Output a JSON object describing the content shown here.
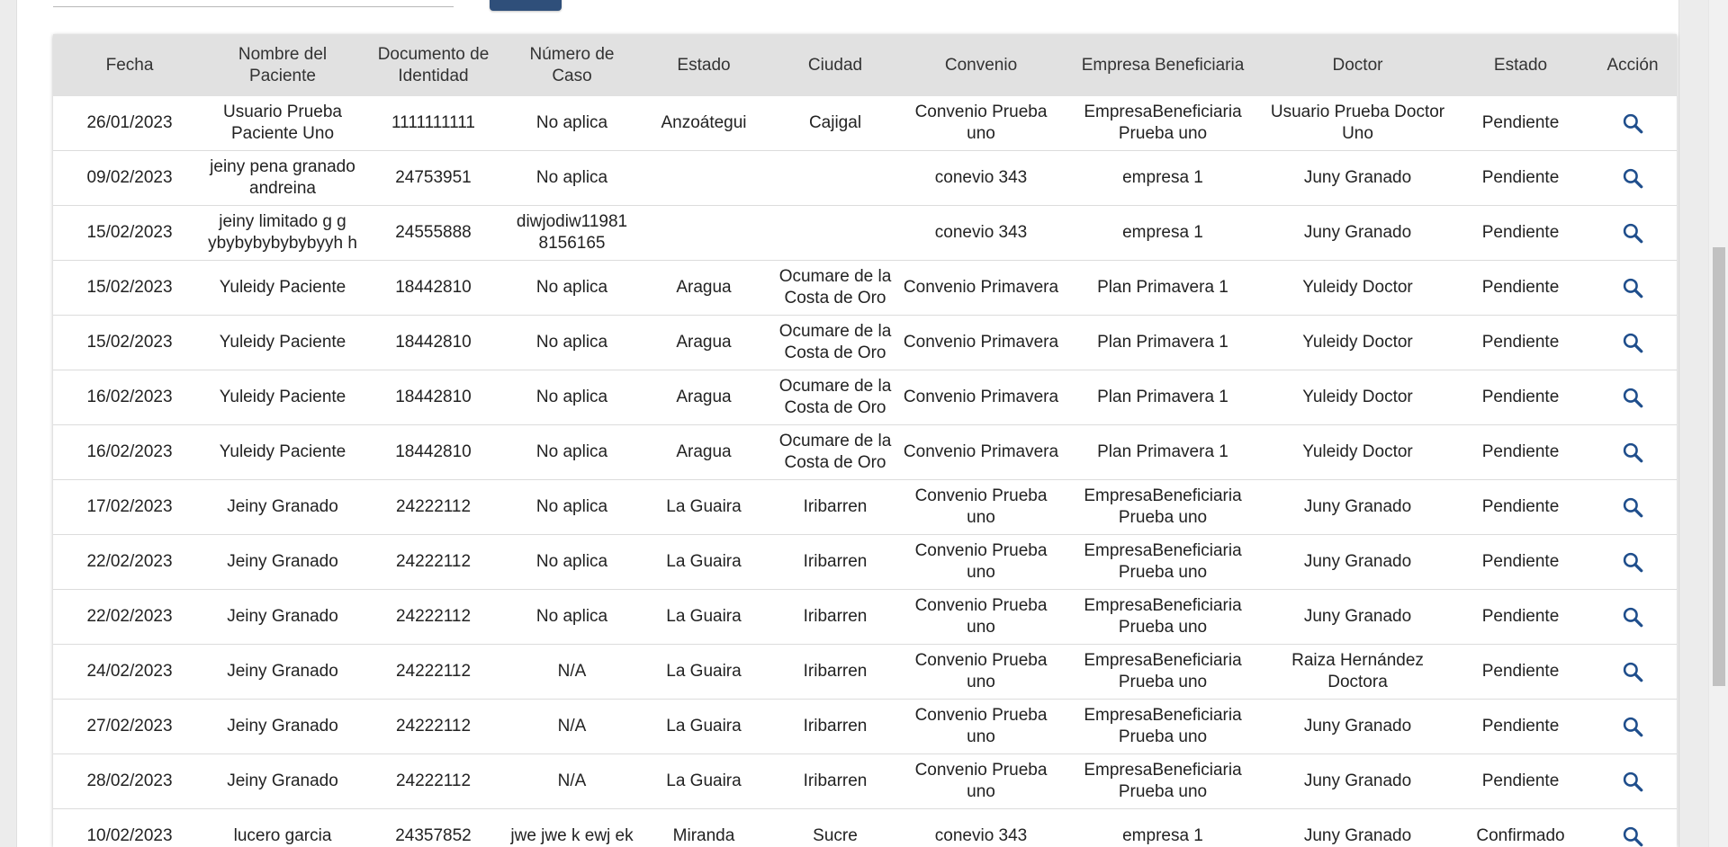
{
  "table": {
    "headers": [
      "Fecha",
      "Nombre del Paciente",
      "Documento de Identidad",
      "Número de Caso",
      "Estado",
      "Ciudad",
      "Convenio",
      "Empresa Beneficiaria",
      "Doctor",
      "Estado",
      "Acción"
    ],
    "action_icon": "search-icon",
    "rows": [
      [
        "26/01/2023",
        "Usuario Prueba Paciente Uno",
        "1111111111",
        "No aplica",
        "Anzoátegui",
        "Cajigal",
        "Convenio Prueba uno",
        "EmpresaBeneficiaria Prueba uno",
        "Usuario Prueba Doctor Uno",
        "Pendiente"
      ],
      [
        "09/02/2023",
        "jeiny pena granado andreina",
        "24753951",
        "No aplica",
        "",
        "",
        "conevio 343",
        "empresa 1",
        "Juny Granado",
        "Pendiente"
      ],
      [
        "15/02/2023",
        "jeiny limitado g g ybybybybybybyyh h",
        "24555888",
        "diwjodiw11981 8156165",
        "",
        "",
        "conevio 343",
        "empresa 1",
        "Juny Granado",
        "Pendiente"
      ],
      [
        "15/02/2023",
        "Yuleidy Paciente",
        "18442810",
        "No aplica",
        "Aragua",
        "Ocumare de la Costa de Oro",
        "Convenio Primavera",
        "Plan Primavera 1",
        "Yuleidy Doctor",
        "Pendiente"
      ],
      [
        "15/02/2023",
        "Yuleidy Paciente",
        "18442810",
        "No aplica",
        "Aragua",
        "Ocumare de la Costa de Oro",
        "Convenio Primavera",
        "Plan Primavera 1",
        "Yuleidy Doctor",
        "Pendiente"
      ],
      [
        "16/02/2023",
        "Yuleidy Paciente",
        "18442810",
        "No aplica",
        "Aragua",
        "Ocumare de la Costa de Oro",
        "Convenio Primavera",
        "Plan Primavera 1",
        "Yuleidy Doctor",
        "Pendiente"
      ],
      [
        "16/02/2023",
        "Yuleidy Paciente",
        "18442810",
        "No aplica",
        "Aragua",
        "Ocumare de la Costa de Oro",
        "Convenio Primavera",
        "Plan Primavera 1",
        "Yuleidy Doctor",
        "Pendiente"
      ],
      [
        "17/02/2023",
        "Jeiny Granado",
        "24222112",
        "No aplica",
        "La Guaira",
        "Iribarren",
        "Convenio Prueba uno",
        "EmpresaBeneficiaria Prueba uno",
        "Juny Granado",
        "Pendiente"
      ],
      [
        "22/02/2023",
        "Jeiny Granado",
        "24222112",
        "No aplica",
        "La Guaira",
        "Iribarren",
        "Convenio Prueba uno",
        "EmpresaBeneficiaria Prueba uno",
        "Juny Granado",
        "Pendiente"
      ],
      [
        "22/02/2023",
        "Jeiny Granado",
        "24222112",
        "No aplica",
        "La Guaira",
        "Iribarren",
        "Convenio Prueba uno",
        "EmpresaBeneficiaria Prueba uno",
        "Juny Granado",
        "Pendiente"
      ],
      [
        "24/02/2023",
        "Jeiny Granado",
        "24222112",
        "N/A",
        "La Guaira",
        "Iribarren",
        "Convenio Prueba uno",
        "EmpresaBeneficiaria Prueba uno",
        "Raiza Hernández Doctora",
        "Pendiente"
      ],
      [
        "27/02/2023",
        "Jeiny Granado",
        "24222112",
        "N/A",
        "La Guaira",
        "Iribarren",
        "Convenio Prueba uno",
        "EmpresaBeneficiaria Prueba uno",
        "Juny Granado",
        "Pendiente"
      ],
      [
        "28/02/2023",
        "Jeiny Granado",
        "24222112",
        "N/A",
        "La Guaira",
        "Iribarren",
        "Convenio Prueba uno",
        "EmpresaBeneficiaria Prueba uno",
        "Juny Granado",
        "Pendiente"
      ],
      [
        "10/02/2023",
        "lucero garcia",
        "24357852",
        "jwe jwe k ewj ek",
        "Miranda",
        "Sucre",
        "conevio 343",
        "empresa 1",
        "Juny Granado",
        "Confirmado"
      ]
    ]
  },
  "colors": {
    "header_bg": "#e1e1e1",
    "accent": "#2f4f7a",
    "action_icon": "#1f4e8c",
    "row_border": "#dcdcdc"
  }
}
